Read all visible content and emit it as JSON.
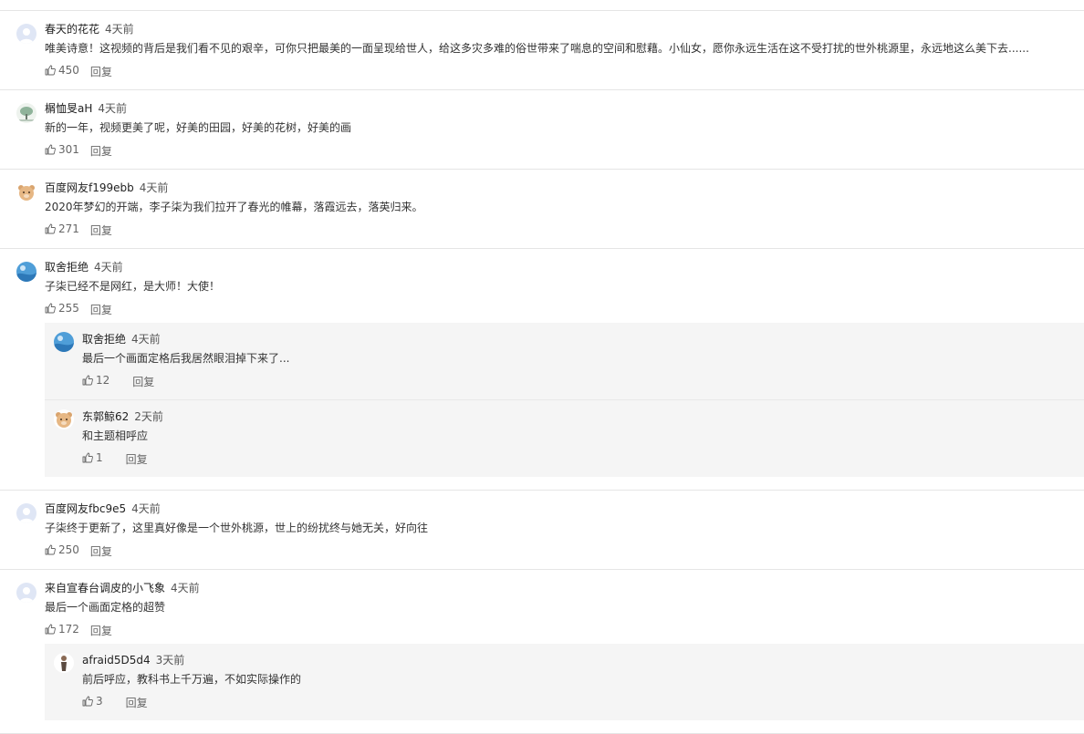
{
  "comments": [
    {
      "user": "春天的花花",
      "time": "4天前",
      "text": "唯美诗意！这视频的背后是我们看不见的艰辛，可你只把最美的一面呈现给世人，给这多灾多难的俗世带来了喘息的空间和慰藉。小仙女，愿你永远生活在这不受打扰的世外桃源里，永远地这么美下去......",
      "likes": "450",
      "reply_label": "回复",
      "avatar": "default-avatar"
    },
    {
      "user": "榍恤旻aH",
      "time": "4天前",
      "text": "新的一年，视频更美了呢，好美的田园，好美的花树，好美的画",
      "likes": "301",
      "reply_label": "回复",
      "avatar": "tree-avatar"
    },
    {
      "user": "百度网友f199ebb",
      "time": "4天前",
      "text": "2020年梦幻的开端，李子柒为我们拉开了春光的帷幕，落霞远去，落英归来。",
      "likes": "271",
      "reply_label": "回复",
      "avatar": "bear-avatar"
    },
    {
      "user": "取舍拒绝",
      "time": "4天前",
      "text": "子柒已经不是网红，是大师！大使！",
      "likes": "255",
      "reply_label": "回复",
      "avatar": "sky-avatar",
      "replies": [
        {
          "user": "取舍拒绝",
          "time": "4天前",
          "text": "最后一个画面定格后我居然眼泪掉下来了...",
          "likes": "12",
          "reply_label": "回复",
          "avatar": "sky-avatar"
        },
        {
          "user": "东郭鲸62",
          "time": "2天前",
          "text": "和主题相呼应",
          "likes": "1",
          "reply_label": "回复",
          "avatar": "bear-avatar"
        }
      ]
    },
    {
      "user": "百度网友fbc9e5",
      "time": "4天前",
      "text": "子柒终于更新了，这里真好像是一个世外桃源，世上的纷扰终与她无关，好向往",
      "likes": "250",
      "reply_label": "回复",
      "avatar": "default-avatar"
    },
    {
      "user": "来自宣春台调皮的小飞象",
      "time": "4天前",
      "text": "最后一个画面定格的超赞",
      "likes": "172",
      "reply_label": "回复",
      "avatar": "default-avatar",
      "replies": [
        {
          "user": "afraid5D5d4",
          "time": "3天前",
          "text": "前后呼应，教科书上千万遍，不如实际操作的",
          "likes": "3",
          "reply_label": "回复",
          "avatar": "figure-avatar"
        }
      ]
    }
  ],
  "colors": {
    "divider": "#e5e5e5",
    "reply_background": "#f5f5f5",
    "text": "#333333",
    "meta": "#666666"
  }
}
